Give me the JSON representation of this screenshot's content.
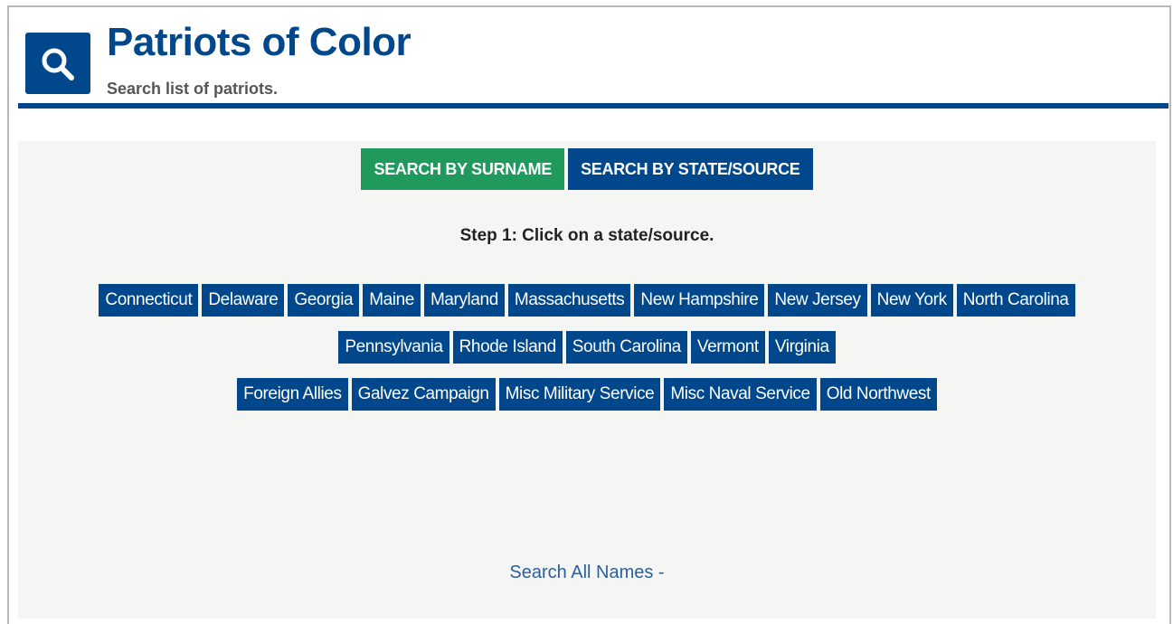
{
  "header": {
    "title": "Patriots of Color",
    "subtitle": "Search list of patriots."
  },
  "tabs": [
    {
      "label": "SEARCH BY SURNAME",
      "color": "#1f9a5c"
    },
    {
      "label": "SEARCH BY STATE/SOURCE",
      "color": "#00478b",
      "active": true
    }
  ],
  "instruction": "Step 1: Click on a state/source.",
  "states": {
    "row1": [
      "Connecticut",
      "Delaware",
      "Georgia",
      "Maine",
      "Maryland",
      "Massachusetts",
      "New Hampshire",
      "New Jersey",
      "New York",
      "North Carolina"
    ],
    "row2": [
      "Pennsylvania",
      "Rhode Island",
      "South Carolina",
      "Vermont",
      "Virginia"
    ],
    "row3": [
      "Foreign Allies",
      "Galvez Campaign",
      "Misc Military Service",
      "Misc Naval Service",
      "Old Northwest"
    ]
  },
  "search_all": "Search All Names -",
  "colors": {
    "brand_blue": "#00478b",
    "green": "#1f9a5c",
    "panel_bg": "#f5f5f3",
    "link": "#2a5fa0"
  },
  "icons": {
    "logo": "search-icon"
  }
}
